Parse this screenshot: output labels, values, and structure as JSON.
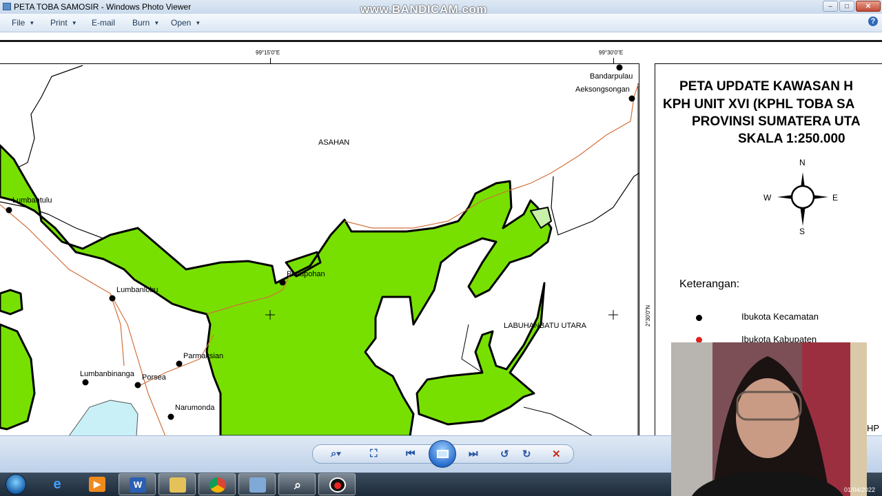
{
  "window": {
    "title": "PETA TOBA SAMOSIR - Windows Photo Viewer",
    "watermark": "www.BANDICAM.com",
    "minimize_glyph": "–",
    "maximize_glyph": "□",
    "close_glyph": "✕"
  },
  "menu": {
    "file": "File",
    "print": "Print",
    "email": "E-mail",
    "burn": "Burn",
    "open": "Open",
    "help": "?"
  },
  "map": {
    "coord_top_1": "99°15'0\"E",
    "coord_top_2": "99°30'0\"E",
    "coord_right": "2°30'0\"N",
    "region_labels": {
      "asahan": "ASAHAN",
      "labuhanbatu": "LABUHANBATU UTARA"
    },
    "places": {
      "bandarpulau": "Bandarpulau",
      "aeksongsongan": "Aeksongsongan",
      "lumbantuulu": "Lumbantulu",
      "pintupohan": "Pintupohan",
      "lumbanlobu": "Lumbanlobu",
      "parmaksian": "Parmaksian",
      "lumbanbinanga": "Lumbanbinanga",
      "porsea": "Porsea",
      "narumonda": "Narumonda"
    },
    "colors": {
      "forest": "#77e000",
      "light_forest": "#c7f0a8",
      "lake": "#c9f0f7",
      "road": "#d2703c"
    }
  },
  "legend": {
    "title_line1": "PETA UPDATE KAWASAN H",
    "title_line2": "KPH UNIT XVI (KPHL TOBA SA",
    "title_line3": "PROVINSI SUMATERA UTA",
    "title_line4": "SKALA 1:250.000",
    "compass": {
      "n": "N",
      "s": "S",
      "e": "E",
      "w": "W"
    },
    "keterangan": "Keterangan:",
    "items": [
      {
        "label": "Ibukota Kecamatan",
        "color": "#000000"
      },
      {
        "label": "Ibukota Kabupaten",
        "color": "#e02020"
      }
    ],
    "edge_text": "HP"
  },
  "taskbar": {
    "clock_date": "01/04/2022",
    "icons": [
      "start-orb",
      "internet-explorer-icon",
      "media-player-icon",
      "word-icon",
      "explorer-folder-icon",
      "chrome-icon",
      "photo-viewer-icon",
      "search-magnifier-icon",
      "bandicam-record-icon"
    ]
  }
}
